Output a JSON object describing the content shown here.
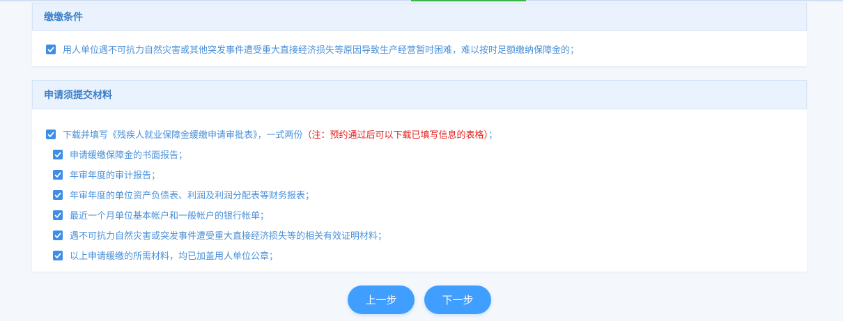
{
  "conditions": {
    "title": "缴缴条件",
    "items": [
      {
        "text": "用人单位遇不可抗力自然灾害或其他突发事件遭受重大直接经济损失等原因导致生产经营暂时困难，难以按时足额缴纳保障金的；",
        "checked": true
      }
    ]
  },
  "materials": {
    "title": "申请须提交材料",
    "main_item": {
      "text": "下载并填写《残疾人就业保障金缓缴申请审批表》，一式两份",
      "note": "（注：预约通过后可以下载已填写信息的表格）",
      "suffix": "；",
      "checked": true
    },
    "sub_items": [
      {
        "text": "申请缓缴保障金的书面报告；",
        "checked": true
      },
      {
        "text": "年审年度的审计报告；",
        "checked": true
      },
      {
        "text": "年审年度的单位资产负债表、利润及利润分配表等财务报表；",
        "checked": true
      },
      {
        "text": "最近一个月单位基本帐户和一般帐户的银行帐单；",
        "checked": true
      },
      {
        "text": "遇不可抗力自然灾害或突发事件遭受重大直接经济损失等的相关有效证明材料；",
        "checked": true
      },
      {
        "text": "以上申请缓缴的所需材料，均已加盖用人单位公章；",
        "checked": true
      }
    ]
  },
  "buttons": {
    "prev_label": "上一步",
    "next_label": "下一步"
  },
  "colors": {
    "accent": "#409eff",
    "header_bg": "#e9f2fd",
    "text": "#4a90d9",
    "note": "#e0201e"
  }
}
